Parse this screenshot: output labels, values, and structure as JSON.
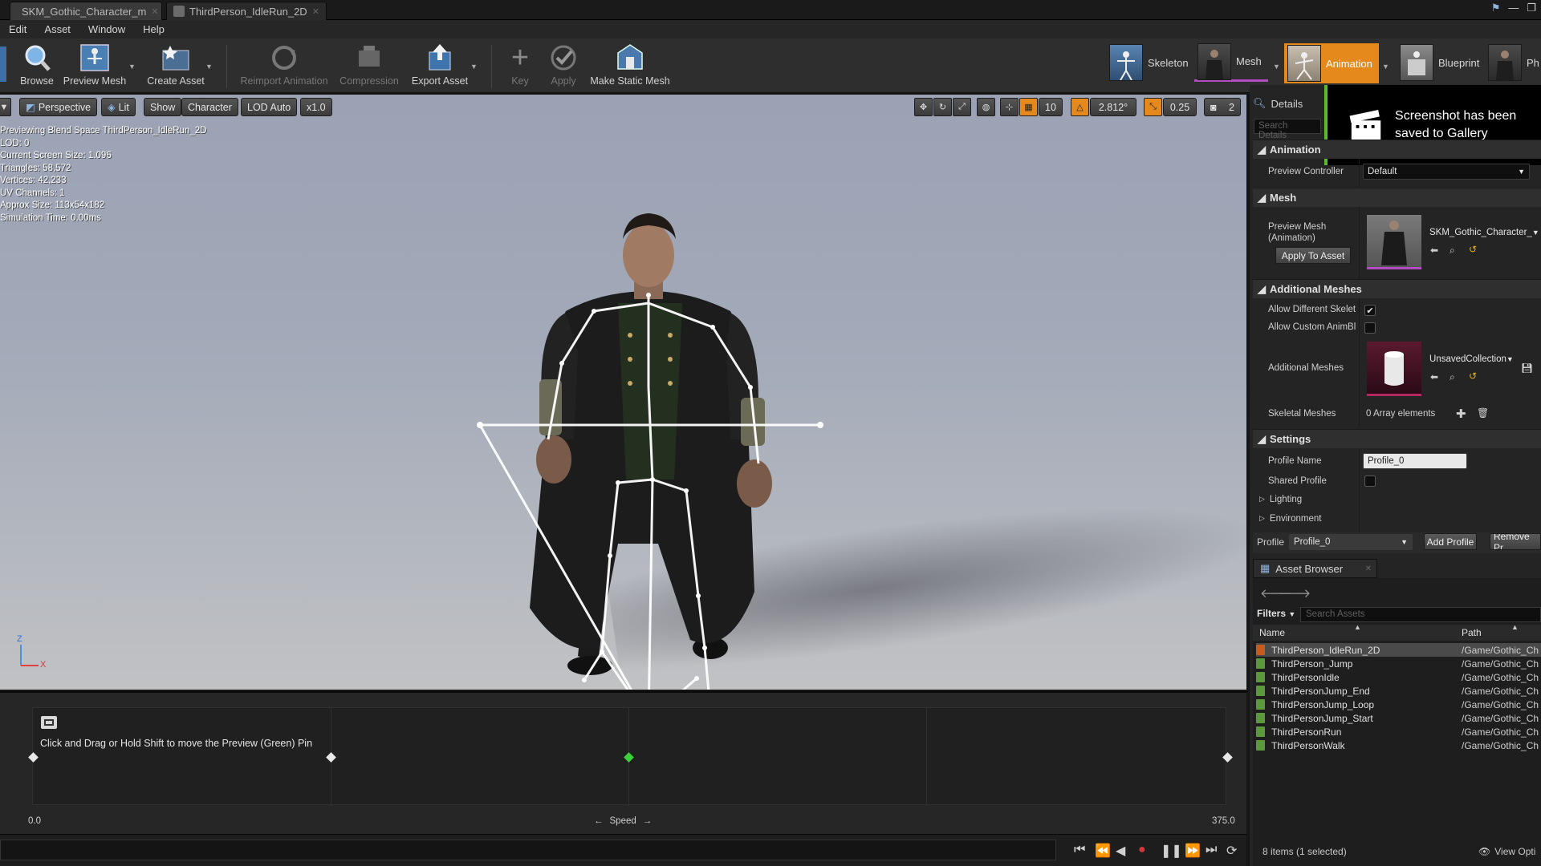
{
  "tabs": [
    {
      "label": "SKM_Gothic_Character_m"
    },
    {
      "label": "ThirdPerson_IdleRun_2D"
    }
  ],
  "menu": [
    "Edit",
    "Asset",
    "Window",
    "Help"
  ],
  "toolbar": {
    "browse": "Browse",
    "preview_mesh": "Preview Mesh",
    "create_asset": "Create Asset",
    "reimport": "Reimport Animation",
    "compression": "Compression",
    "export_asset": "Export Asset",
    "key": "Key",
    "apply": "Apply",
    "make_static_mesh": "Make Static Mesh"
  },
  "modes": {
    "skeleton": "Skeleton",
    "mesh": "Mesh",
    "animation": "Animation",
    "blueprint": "Blueprint",
    "physics": "Ph"
  },
  "viewport": {
    "perspective": "Perspective",
    "lit": "Lit",
    "show": "Show",
    "character": "Character",
    "lod": "LOD Auto",
    "speed": "x1.0",
    "grid_snap": "10",
    "rot_snap": "2.812°",
    "scale_snap": "0.25",
    "cam_speed": "2",
    "stats": [
      "Previewing Blend Space ThirdPerson_IdleRun_2D",
      "LOD: 0",
      "Current Screen Size: 1.096",
      "Triangles: 58,572",
      "Vertices: 42,233",
      "UV Channels: 1",
      "Approx Size: 113x54x182",
      "Simulation Time: 0.00ms"
    ],
    "axis_z": "Z",
    "axis_x": "X"
  },
  "blend": {
    "hint": "Click and Drag or Hold Shift to move the Preview (Green) Pin",
    "min": "0.0",
    "max": "375.0",
    "axis_label": "Speed"
  },
  "details": {
    "title": "Details",
    "search_placeholder": "Search Details",
    "toast": "Screenshot has been saved to Gallery",
    "cat_animation": "Animation",
    "preview_controller_label": "Preview Controller",
    "preview_controller_value": "Default",
    "cat_mesh": "Mesh",
    "preview_mesh_label": "Preview Mesh (Animation)",
    "preview_mesh_value": "SKM_Gothic_Character_",
    "apply_to_asset": "Apply To Asset",
    "cat_additional": "Additional Meshes",
    "allow_diff_skel": "Allow Different Skelet",
    "allow_custom_anim": "Allow Custom AnimBl",
    "additional_meshes_label": "Additional Meshes",
    "additional_meshes_value": "UnsavedCollection",
    "skeletal_meshes_label": "Skeletal Meshes",
    "skeletal_meshes_value": "0 Array elements",
    "cat_settings": "Settings",
    "profile_name_label": "Profile Name",
    "profile_name_value": "Profile_0",
    "shared_profile_label": "Shared Profile",
    "lighting": "Lighting",
    "environment": "Environment",
    "profile_label": "Profile",
    "profile_value": "Profile_0",
    "add_profile": "Add Profile",
    "remove_profile": "Remove Pr"
  },
  "asset_browser": {
    "tab": "Asset Browser",
    "filters": "Filters",
    "search_placeholder": "Search Assets",
    "col_name": "Name",
    "col_path": "Path",
    "rows": [
      {
        "name": "ThirdPerson_IdleRun_2D",
        "path": "/Game/Gothic_Ch"
      },
      {
        "name": "ThirdPerson_Jump",
        "path": "/Game/Gothic_Ch"
      },
      {
        "name": "ThirdPersonIdle",
        "path": "/Game/Gothic_Ch"
      },
      {
        "name": "ThirdPersonJump_End",
        "path": "/Game/Gothic_Ch"
      },
      {
        "name": "ThirdPersonJump_Loop",
        "path": "/Game/Gothic_Ch"
      },
      {
        "name": "ThirdPersonJump_Start",
        "path": "/Game/Gothic_Ch"
      },
      {
        "name": "ThirdPersonRun",
        "path": "/Game/Gothic_Ch"
      },
      {
        "name": "ThirdPersonWalk",
        "path": "/Game/Gothic_Ch"
      }
    ],
    "status": "8 items (1 selected)",
    "view_options": "View Opti"
  },
  "colors": {
    "accent": "#e6891c",
    "toast_bar": "#5bbb2c",
    "preview_pin": "#3ad13a"
  }
}
